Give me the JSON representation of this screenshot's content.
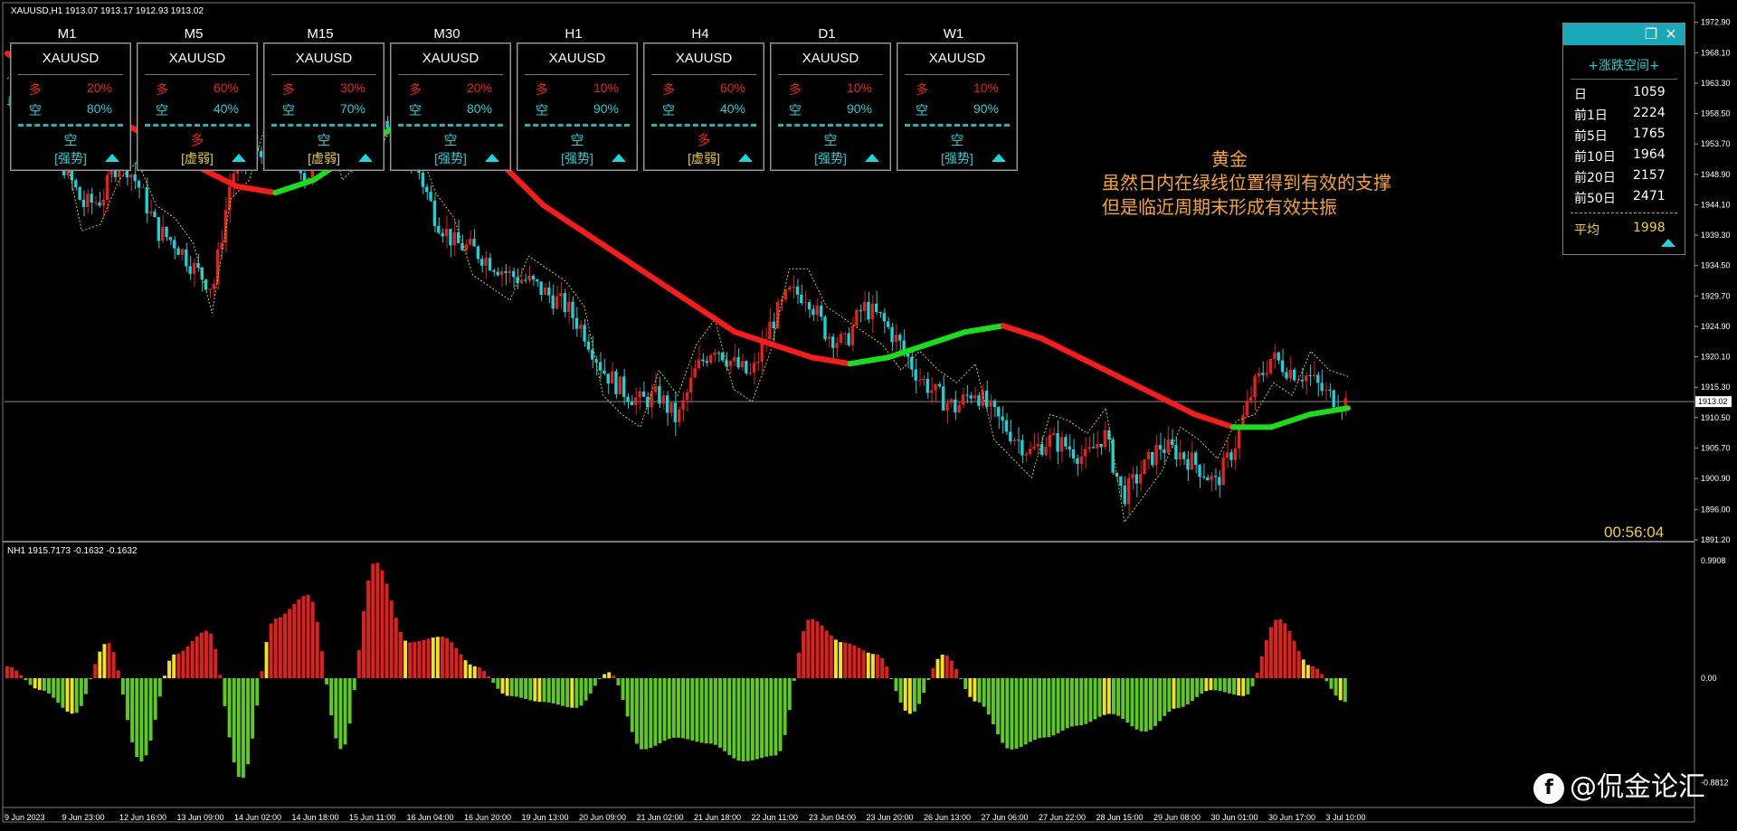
{
  "chart_title": "XAUUSD,H1  1913.07 1913.17 1912.93 1913.02",
  "indicator_title": "NH1 1915.7173 -0.1632 -0.1632",
  "timer": "00:56:04",
  "current_price": "1913.02",
  "annotation": {
    "title": "黄金",
    "line1": "虽然日内在绿线位置得到有效的支撑",
    "line2": "但是临近周期末形成有效共振"
  },
  "watermark": "@侃金论汇",
  "watermark_logo": "f",
  "timeframes": [
    {
      "tf": "M1",
      "symbol": "XAUUSD",
      "long_label": "多",
      "long": "20%",
      "short_label": "空",
      "short": "80%",
      "direction": "空",
      "dir_color": "cyan",
      "strength": "[强势]",
      "str_color": "cyan"
    },
    {
      "tf": "M5",
      "symbol": "XAUUSD",
      "long_label": "多",
      "long": "60%",
      "short_label": "空",
      "short": "40%",
      "direction": "多",
      "dir_color": "red",
      "strength": "[虚弱]",
      "str_color": "yellow"
    },
    {
      "tf": "M15",
      "symbol": "XAUUSD",
      "long_label": "多",
      "long": "30%",
      "short_label": "空",
      "short": "70%",
      "direction": "空",
      "dir_color": "cyan",
      "strength": "[虚弱]",
      "str_color": "yellow"
    },
    {
      "tf": "M30",
      "symbol": "XAUUSD",
      "long_label": "多",
      "long": "20%",
      "short_label": "空",
      "short": "80%",
      "direction": "空",
      "dir_color": "cyan",
      "strength": "[强势]",
      "str_color": "cyan"
    },
    {
      "tf": "H1",
      "symbol": "XAUUSD",
      "long_label": "多",
      "long": "10%",
      "short_label": "空",
      "short": "90%",
      "direction": "空",
      "dir_color": "cyan",
      "strength": "[强势]",
      "str_color": "cyan"
    },
    {
      "tf": "H4",
      "symbol": "XAUUSD",
      "long_label": "多",
      "long": "60%",
      "short_label": "空",
      "short": "40%",
      "direction": "多",
      "dir_color": "red",
      "strength": "[虚弱]",
      "str_color": "yellow"
    },
    {
      "tf": "D1",
      "symbol": "XAUUSD",
      "long_label": "多",
      "long": "10%",
      "short_label": "空",
      "short": "90%",
      "direction": "空",
      "dir_color": "cyan",
      "strength": "[强势]",
      "str_color": "cyan"
    },
    {
      "tf": "W1",
      "symbol": "XAUUSD",
      "long_label": "多",
      "long": "10%",
      "short_label": "空",
      "short": "90%",
      "direction": "空",
      "dir_color": "cyan",
      "strength": "[强势]",
      "str_color": "cyan"
    }
  ],
  "stats": {
    "heading": "+涨跌空间+",
    "rows": [
      {
        "k": "日",
        "v": "1059"
      },
      {
        "k": "前1日",
        "v": "2224"
      },
      {
        "k": "前5日",
        "v": "1765"
      },
      {
        "k": "前10日",
        "v": "1964"
      },
      {
        "k": "前20日",
        "v": "2157"
      },
      {
        "k": "前50日",
        "v": "2471"
      }
    ],
    "avg_label": "平均",
    "avg_value": "1998",
    "restore_icon": "restore-icon",
    "close_icon": "close-icon"
  },
  "price_axis": [
    "1972.90",
    "1968.10",
    "1963.30",
    "1958.50",
    "1953.70",
    "1948.90",
    "1944.10",
    "1939.30",
    "1934.50",
    "1929.70",
    "1924.90",
    "1920.10",
    "1915.30",
    "1910.50",
    "1905.70",
    "1900.90",
    "1896.00",
    "1891.20"
  ],
  "indicator_axis": [
    "0.9908",
    "0.00",
    "-0.8812"
  ],
  "time_axis": [
    "9 Jun 2023",
    "9 Jun 23:00",
    "12 Jun 16:00",
    "13 Jun 09:00",
    "14 Jun 02:00",
    "14 Jun 18:00",
    "15 Jun 11:00",
    "16 Jun 04:00",
    "16 Jun 20:00",
    "19 Jun 13:00",
    "20 Jun 09:00",
    "21 Jun 02:00",
    "21 Jun 18:00",
    "22 Jun 11:00",
    "23 Jun 04:00",
    "23 Jun 20:00",
    "26 Jun 13:00",
    "27 Jun 06:00",
    "27 Jun 22:00",
    "28 Jun 15:00",
    "29 Jun 08:00",
    "30 Jun 01:00",
    "30 Jun 17:00",
    "3 Jul 10:00"
  ],
  "colors": {
    "bull": "#e8201c",
    "bear": "#19d3d8",
    "ma_down": "#ff1a1a",
    "ma_up": "#18e018",
    "hist_pos": "#e0201c",
    "hist_neg": "#5ec91e",
    "hist_warn": "#f1e31c",
    "grid": "#2a2a2a"
  },
  "chart_data": {
    "type": "candlestick",
    "symbol": "XAUUSD",
    "timeframe": "H1",
    "ylim": [
      1891.2,
      1975.0
    ],
    "close_path": [
      1960,
      1962,
      1958,
      1950,
      1944,
      1945,
      1952,
      1947,
      1940,
      1938,
      1934,
      1931,
      1949,
      1952,
      1954,
      1957,
      1948,
      1955,
      1952,
      1955,
      1957,
      1954,
      1950,
      1942,
      1938,
      1937,
      1935,
      1933,
      1932,
      1930,
      1928,
      1924,
      1918,
      1915,
      1913,
      1914,
      1910,
      1918,
      1922,
      1919,
      1917,
      1925,
      1930,
      1930,
      1924,
      1922,
      1928,
      1926,
      1922,
      1917,
      1914,
      1912,
      1915,
      1911,
      1908,
      1905,
      1907,
      1906,
      1904,
      1908,
      1898,
      1902,
      1906,
      1905,
      1903,
      1900,
      1906,
      1915,
      1920,
      1918,
      1917,
      1914,
      1913
    ],
    "ma_line": [
      1968,
      1964,
      1960,
      1957,
      1954,
      1950,
      1947,
      1946,
      1948,
      1952,
      1956,
      1958,
      1956,
      1950,
      1944,
      1940,
      1936,
      1932,
      1928,
      1924,
      1922,
      1920,
      1919,
      1920,
      1922,
      1924,
      1925,
      1923,
      1920,
      1917,
      1914,
      1911,
      1909,
      1909,
      1911,
      1912
    ],
    "oscillator": [
      0.1,
      -0.1,
      -0.3,
      0.3,
      -0.7,
      0.2,
      0.4,
      -0.85,
      0.5,
      0.7,
      -0.6,
      0.98,
      0.3,
      0.35,
      0.1,
      -0.15,
      -0.2,
      -0.25,
      0.05,
      -0.6,
      -0.5,
      -0.55,
      -0.7,
      -0.65,
      0.5,
      0.3,
      0.2,
      -0.3,
      0.2,
      -0.2,
      -0.6,
      -0.5,
      -0.4,
      -0.3,
      -0.45,
      -0.25,
      -0.1,
      -0.15,
      0.5,
      0.1,
      -0.2
    ]
  }
}
